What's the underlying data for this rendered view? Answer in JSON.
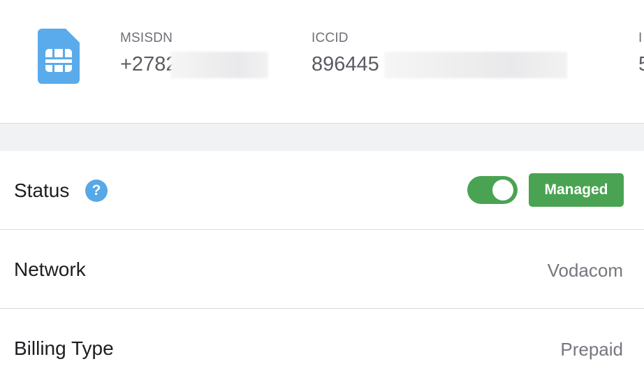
{
  "header": {
    "fields": [
      {
        "label": "MSISDN",
        "value": "+2782"
      },
      {
        "label": "ICCID",
        "value": "896445"
      },
      {
        "label": "I",
        "value": "5"
      }
    ]
  },
  "rows": {
    "status": {
      "label": "Status",
      "help_glyph": "?",
      "toggle_on": true,
      "badge": "Managed"
    },
    "network": {
      "label": "Network",
      "value": "Vodacom"
    },
    "billing": {
      "label": "Billing Type",
      "value": "Prepaid"
    }
  },
  "colors": {
    "sim_icon": "#5aabeb",
    "help_icon": "#57a8e6",
    "toggle_on": "#4aa352",
    "badge_bg": "#4aa352",
    "section_gap": "#f1f2f4"
  }
}
